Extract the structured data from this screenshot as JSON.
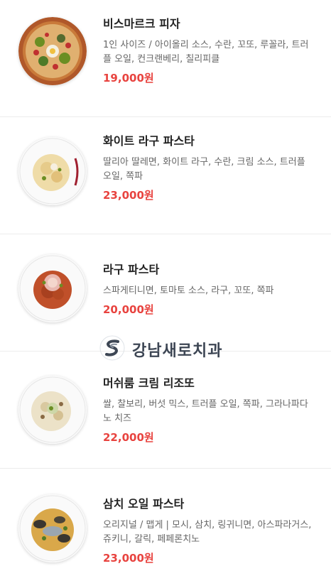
{
  "menu": {
    "items": [
      {
        "name": "비스마르크 피자",
        "description": "1인 사이즈 / 아이올리 소스, 수란, 꼬또, 루꼴라, 트러플 오일, 컨크랜베리, 칠리피클",
        "price": "19,000원",
        "photo_icon": "pizza-photo"
      },
      {
        "name": "화이트 라구 파스타",
        "description": "딸리아 딸레면, 화이트 라구, 수란, 크림 소스, 트러플 오일, 쪽파",
        "price": "23,000원",
        "photo_icon": "white-ragu-pasta-photo"
      },
      {
        "name": "라구 파스타",
        "description": "스파게티니면, 토마토 소스, 라구, 꼬또, 쪽파",
        "price": "20,000원",
        "photo_icon": "ragu-pasta-photo"
      },
      {
        "name": "머쉬룸 크림 리조또",
        "description": "쌀, 찰보리, 버섯 믹스, 트러플 오일, 쪽파, 그라나파다노 치즈",
        "price": "22,000원",
        "photo_icon": "mushroom-risotto-photo"
      },
      {
        "name": "삼치 오일 파스타",
        "description": "오리지널 / 맵게 | 모시, 삼치, 링귀니면, 아스파라거스, 쥬키니, 갈릭, 페페론치노",
        "price": "23,000원",
        "photo_icon": "mackerel-oil-pasta-photo"
      }
    ]
  },
  "watermark": {
    "text": "강남새로치과",
    "icon": "swirl-logo-icon"
  },
  "colors": {
    "price": "#e8433f",
    "name": "#222222",
    "description": "#666666",
    "divider": "#ececec"
  }
}
